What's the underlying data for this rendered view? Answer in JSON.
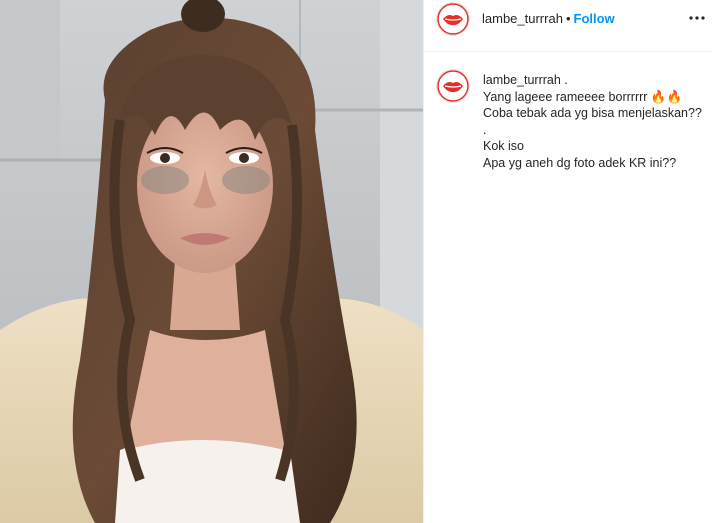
{
  "post": {
    "username": "lambe_turrrah",
    "separator": "•",
    "follow_label": "Follow",
    "avatar_icon": "red-lips-logo",
    "more_icon": "more-options-icon",
    "accent_color": "#0095f6"
  },
  "caption": {
    "username_line": "lambe_turrrah .",
    "lines": [
      "Yang lageee rameeee borrrrrr 🔥🔥",
      "Coba tebak ada yg bisa menjelaskan??",
      ".",
      "Kok iso",
      "Apa yg aneh dg foto adek KR ini??"
    ]
  },
  "media": {
    "type": "photo"
  }
}
